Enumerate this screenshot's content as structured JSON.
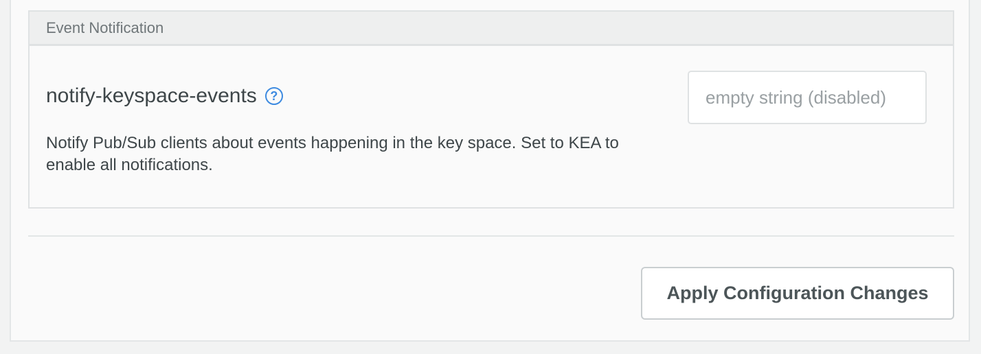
{
  "section": {
    "title": "Event Notification"
  },
  "setting": {
    "name": "notify-keyspace-events",
    "help_icon": "?",
    "description": "Notify Pub/Sub clients about events happening in the key space. Set to KEA to enable all notifications.",
    "input_value": "",
    "input_placeholder": "empty string (disabled)"
  },
  "actions": {
    "apply_label": "Apply Configuration Changes"
  },
  "colors": {
    "accent": "#3d8ae0",
    "text": "#3e4649",
    "border": "#dfe2e3"
  }
}
